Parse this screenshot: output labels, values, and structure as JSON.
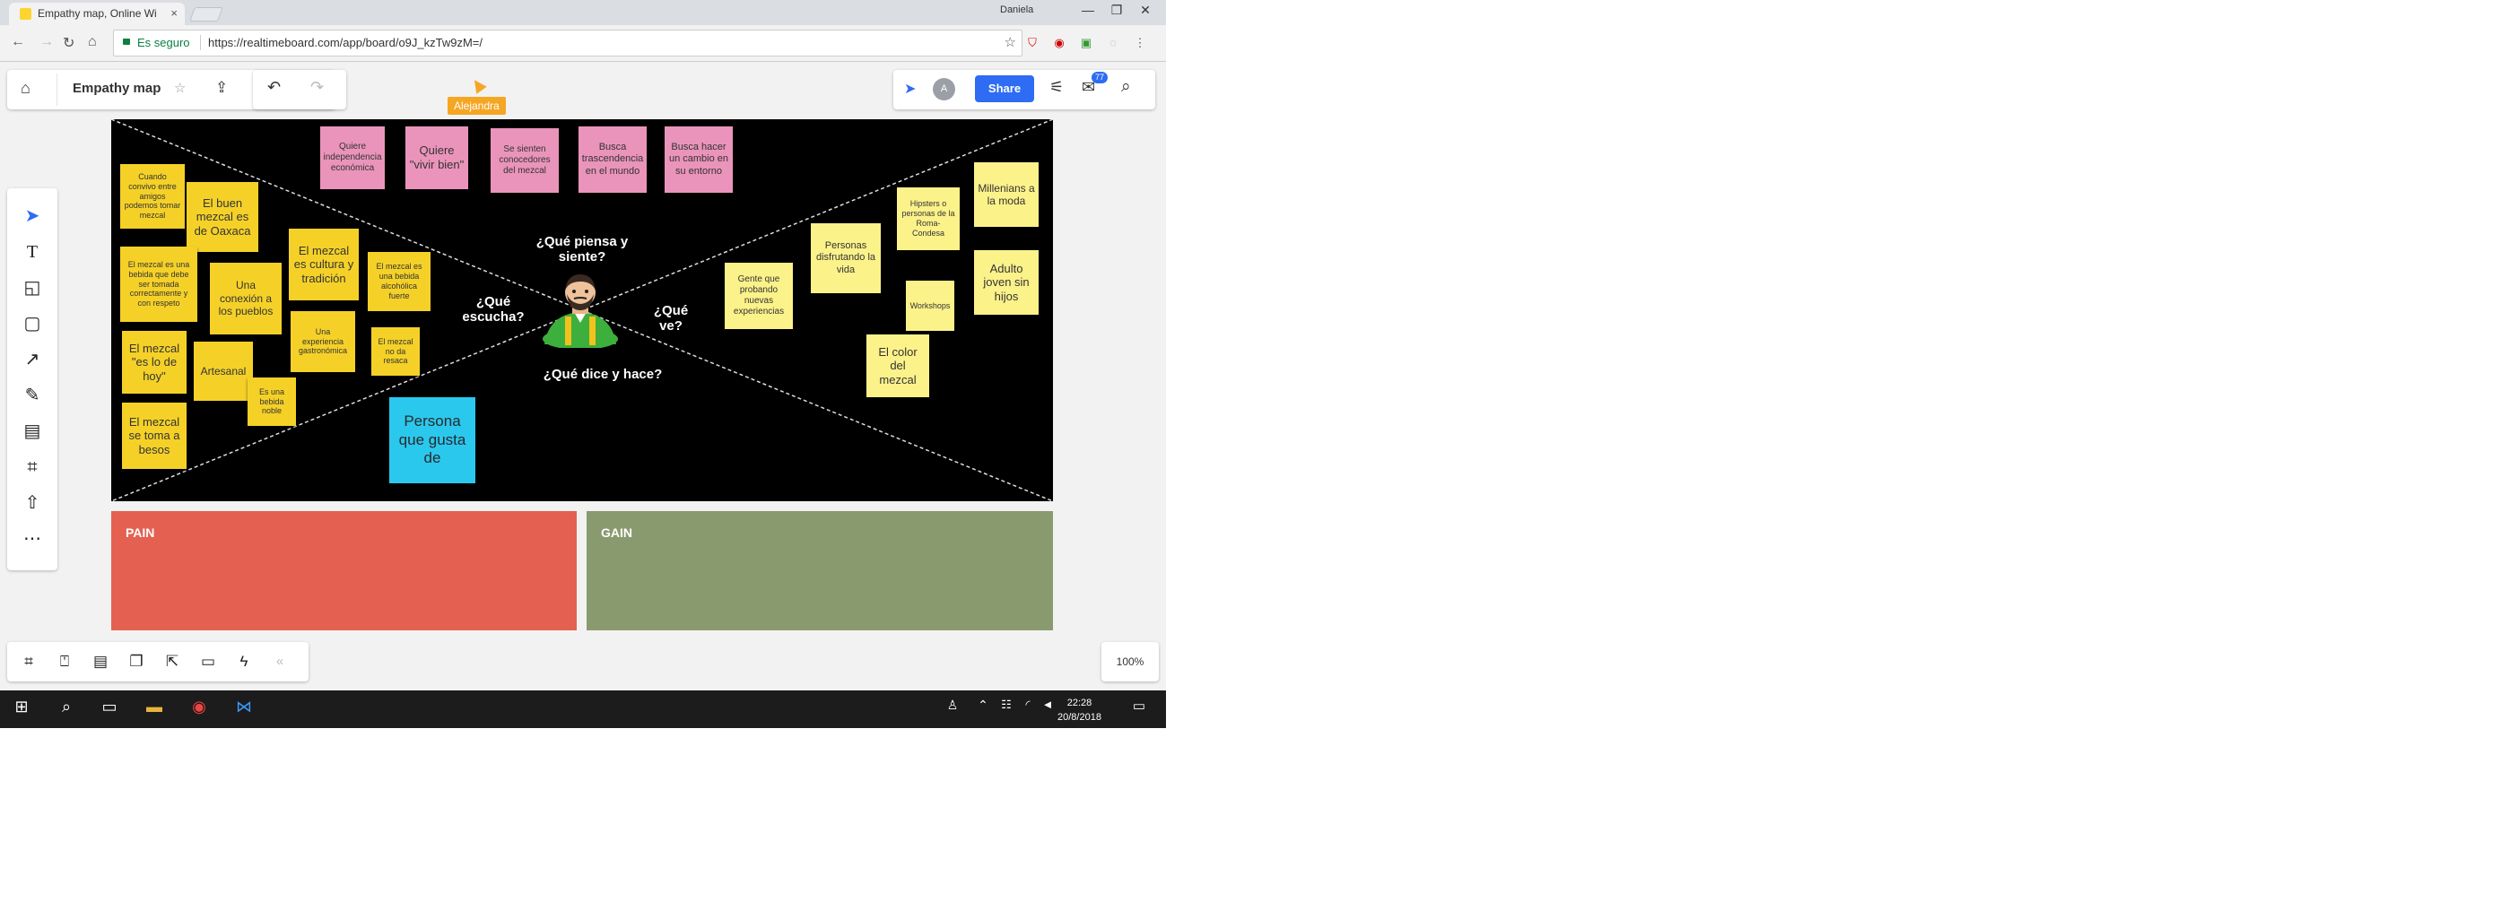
{
  "browser": {
    "tab_title": "Empathy map, Online Wi",
    "tab_close": "×",
    "user_badge": "Daniela",
    "window_controls": [
      "—",
      "❐",
      "✕"
    ],
    "secure_label": "Es seguro",
    "url": "https://realtimeboard.com/app/board/o9J_kzTw9zM=/"
  },
  "app": {
    "board_name": "Empathy map",
    "share_label": "Share",
    "avatar_initial": "A",
    "notification_count": "77",
    "collaborator_cursor_name": "Alejandra",
    "zoom_level": "100%"
  },
  "canvas": {
    "questions": {
      "thinks": "¿Qué piensa y siente?",
      "hears": "¿Qué escucha?",
      "sees": "¿Qué ve?",
      "says": "¿Qué dice y hace?"
    },
    "notes_top": [
      "Quiere independencia económica",
      "Quiere \"vivir bien\"",
      "Se sienten conocedores del mezcal",
      "Busca trascendencia en el mundo",
      "Busca hacer un cambio en su entorno"
    ],
    "notes_left": [
      "Cuando convivo entre amigos podemos tomar mezcal",
      "El buen mezcal es de Oaxaca",
      "El mezcal es una bebida que debe ser tomada correctamente y con respeto",
      "Una conexión a los pueblos",
      "El mezcal es cultura y tradición",
      "El mezcal es una bebida alcohólica fuerte",
      "El mezcal \"es lo de hoy\"",
      "Artesanal",
      "Una experiencia gastronómica",
      "El mezcal no da resaca",
      "Es una bebida noble",
      "El mezcal se toma a besos"
    ],
    "notes_right": [
      "Hipsters o personas de la Roma-Condesa",
      "Millenians a la moda",
      "Personas disfrutando la vida",
      "Gente que probando nuevas experiencias",
      "Workshops",
      "Adulto joven sin hijos",
      "El color del mezcal"
    ],
    "persona_note": "Persona que gusta de"
  },
  "pain_label": "PAIN",
  "gain_label": "GAIN",
  "taskbar": {
    "time": "22:28",
    "date": "20/8/2018"
  }
}
